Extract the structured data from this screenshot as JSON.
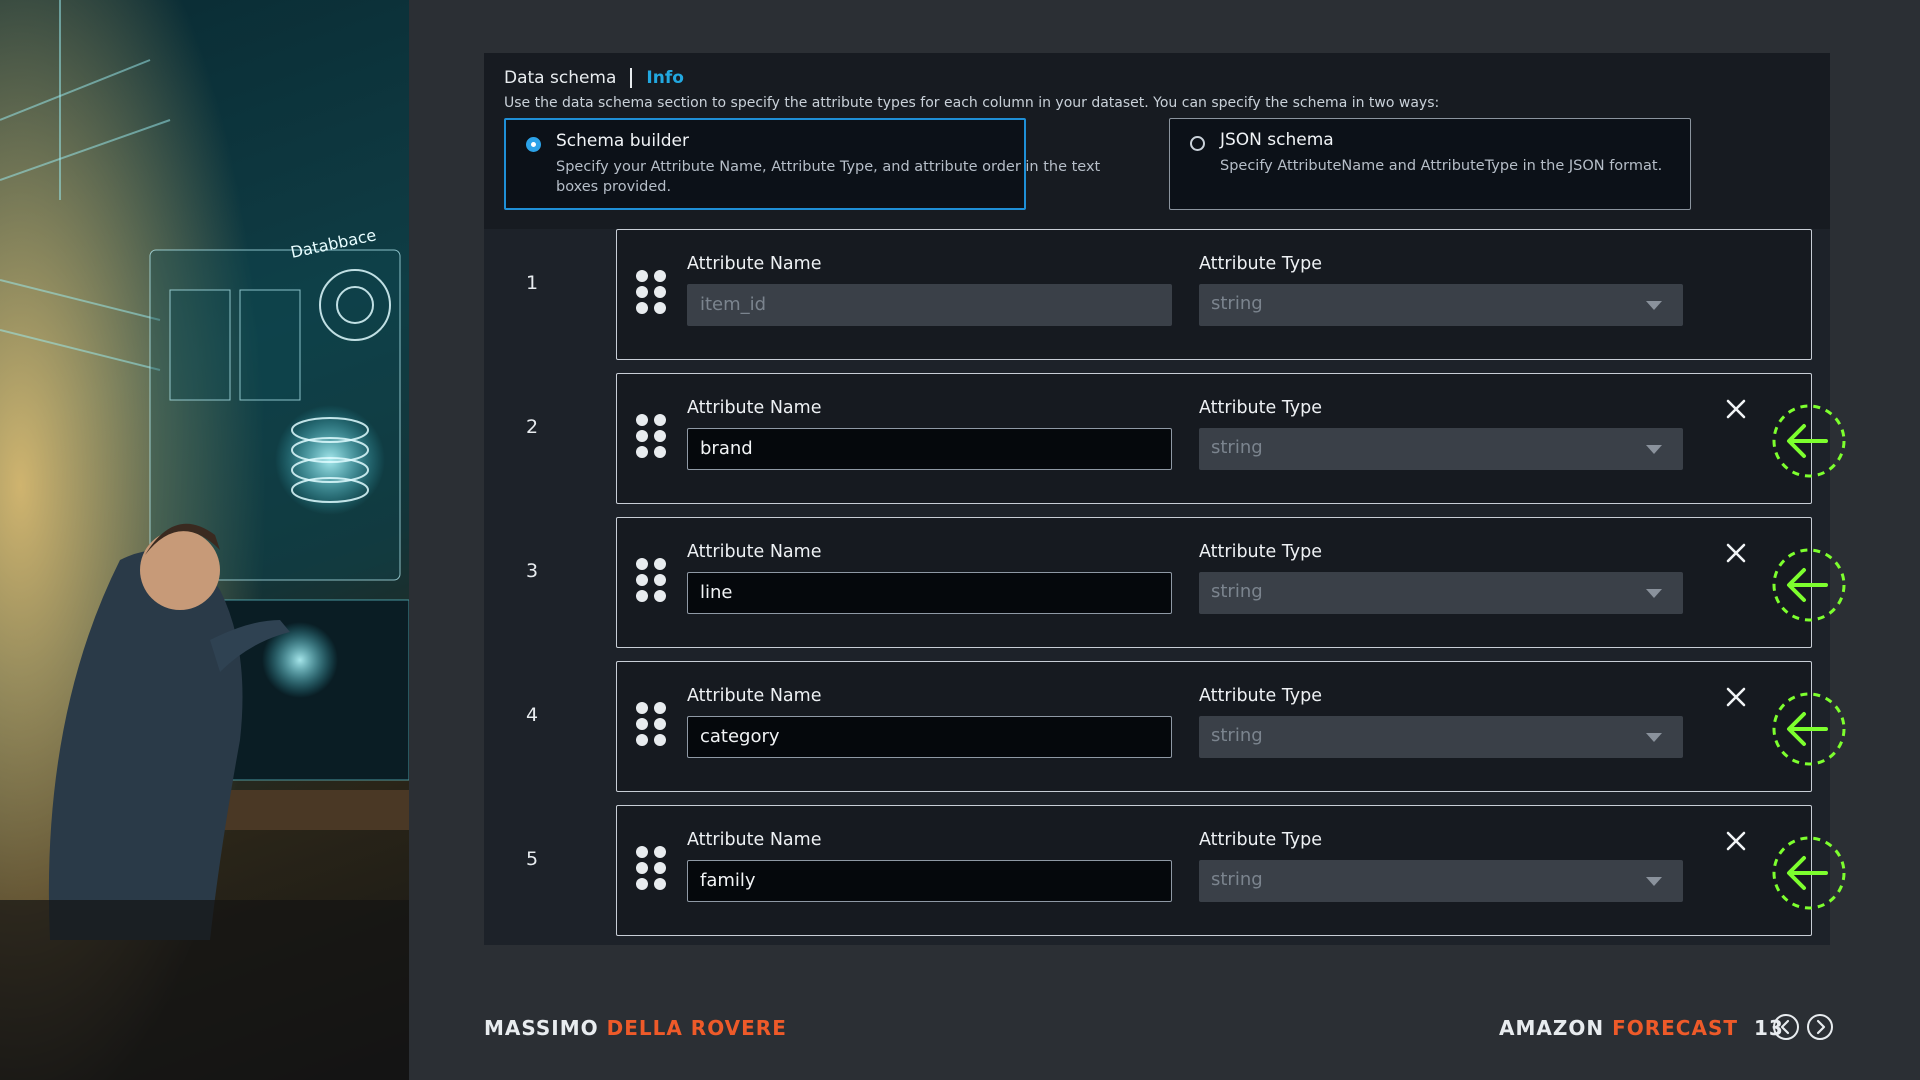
{
  "section": {
    "title": "Data schema",
    "info_link": "Info",
    "description": "Use the data schema section to specify the attribute types for each column in your dataset. You can specify the schema in two ways:"
  },
  "options": [
    {
      "title": "Schema builder",
      "description": "Specify your Attribute Name, Attribute Type, and attribute order in the text boxes provided.",
      "selected": true
    },
    {
      "title": "JSON schema",
      "description": "Specify AttributeName and AttributeType in the JSON format.",
      "selected": false
    }
  ],
  "rows": [
    {
      "index": "1",
      "name_label": "Attribute Name",
      "type_label": "Attribute Type",
      "name_value": "item_id",
      "type_value": "string",
      "removable": false
    },
    {
      "index": "2",
      "name_label": "Attribute Name",
      "type_label": "Attribute Type",
      "name_value": "brand",
      "type_value": "string",
      "removable": true
    },
    {
      "index": "3",
      "name_label": "Attribute Name",
      "type_label": "Attribute Type",
      "name_value": "line",
      "type_value": "string",
      "removable": true
    },
    {
      "index": "4",
      "name_label": "Attribute Name",
      "type_label": "Attribute Type",
      "name_value": "category",
      "type_value": "string",
      "removable": true
    },
    {
      "index": "5",
      "name_label": "Attribute Name",
      "type_label": "Attribute Type",
      "name_value": "family",
      "type_value": "string",
      "removable": true
    }
  ],
  "art": {
    "screen_label": "Databbace"
  },
  "footer": {
    "author_first": "MASSIMO",
    "author_last": "DELLA ROVERE",
    "topic_first": "AMAZON",
    "topic_second": "FORECAST",
    "page": "13"
  },
  "colors": {
    "accent": "#ee5a29",
    "link": "#22a8e0",
    "highlight": "#7dff2e",
    "selected_border": "#1f8fd6"
  }
}
